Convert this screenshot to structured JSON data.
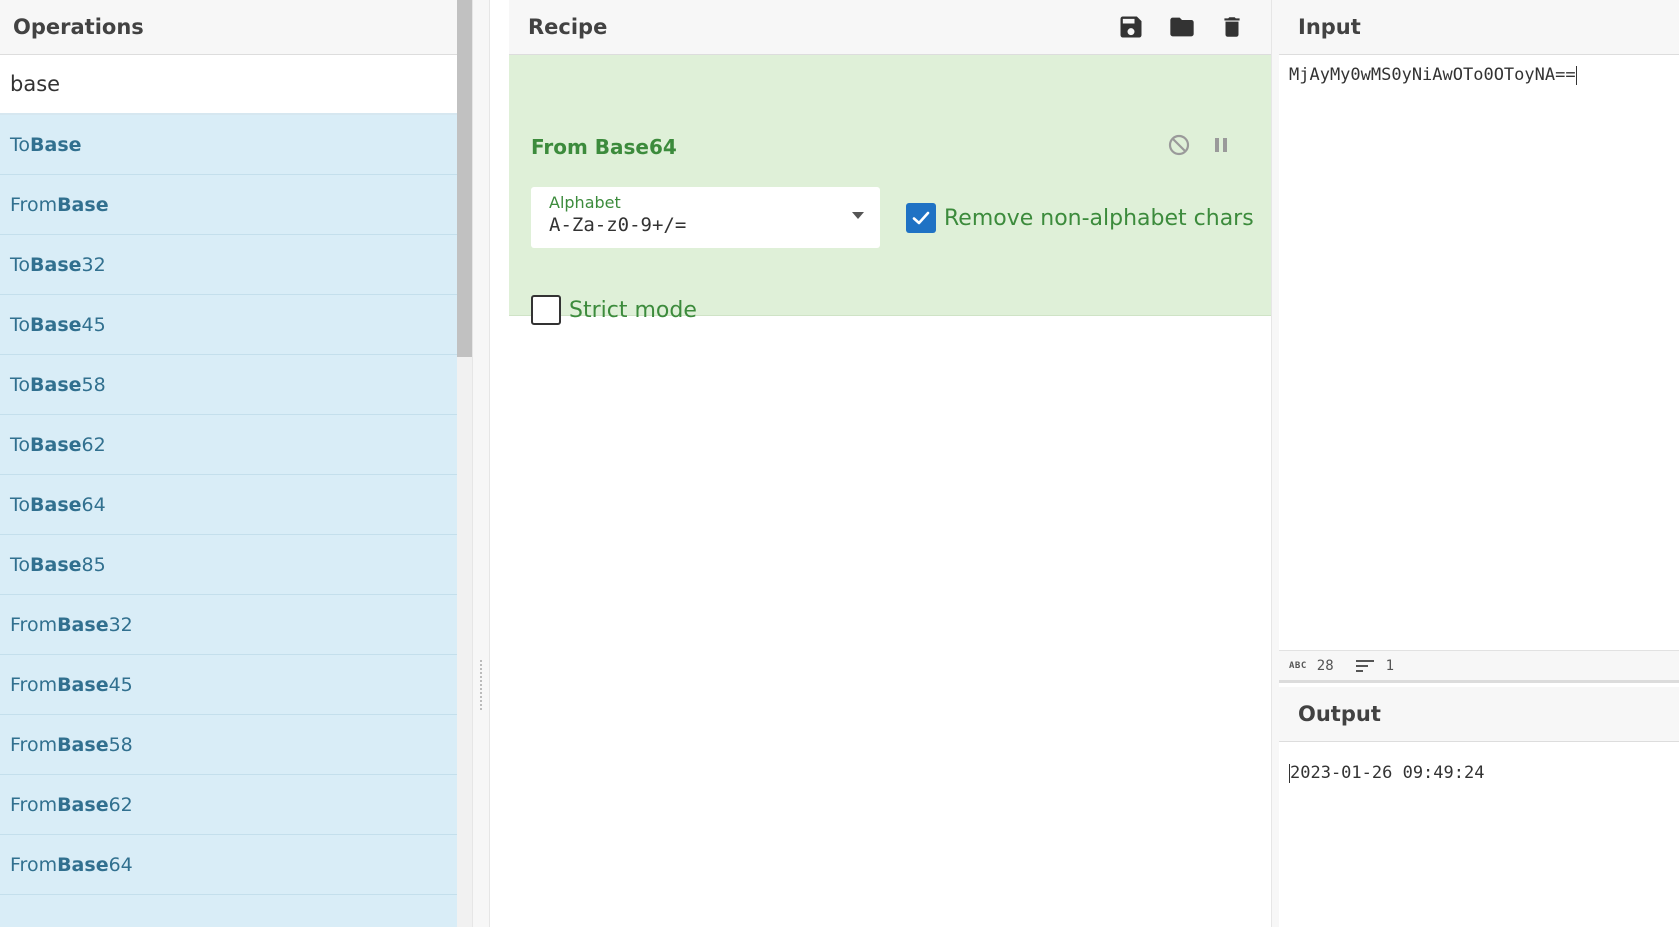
{
  "operations": {
    "title": "Operations",
    "search_value": "base",
    "items": [
      {
        "prefix": "To ",
        "match": "Base",
        "suffix": ""
      },
      {
        "prefix": "From ",
        "match": "Base",
        "suffix": ""
      },
      {
        "prefix": "To ",
        "match": "Base",
        "suffix": "32"
      },
      {
        "prefix": "To ",
        "match": "Base",
        "suffix": "45"
      },
      {
        "prefix": "To ",
        "match": "Base",
        "suffix": "58"
      },
      {
        "prefix": "To ",
        "match": "Base",
        "suffix": "62"
      },
      {
        "prefix": "To ",
        "match": "Base",
        "suffix": "64"
      },
      {
        "prefix": "To ",
        "match": "Base",
        "suffix": "85"
      },
      {
        "prefix": "From ",
        "match": "Base",
        "suffix": "32"
      },
      {
        "prefix": "From ",
        "match": "Base",
        "suffix": "45"
      },
      {
        "prefix": "From ",
        "match": "Base",
        "suffix": "58"
      },
      {
        "prefix": "From ",
        "match": "Base",
        "suffix": "62"
      },
      {
        "prefix": "From ",
        "match": "Base",
        "suffix": "64"
      }
    ]
  },
  "recipe": {
    "title": "Recipe",
    "actions": {
      "save_icon": "save-icon",
      "load_icon": "folder-icon",
      "clear_icon": "trash-icon"
    },
    "operation": {
      "name": "From Base64",
      "alphabet_label": "Alphabet",
      "alphabet_value": "A-Za-z0-9+/=",
      "remove_non_alphabet_label": "Remove non-alphabet chars",
      "remove_non_alphabet_checked": true,
      "strict_mode_label": "Strict mode",
      "strict_mode_checked": false
    }
  },
  "input": {
    "title": "Input",
    "text": "MjAyMy0wMS0yNiAwOTo0OToyNA==",
    "stats": {
      "abc_label": "ABC",
      "length": "28",
      "lines": "1"
    }
  },
  "output": {
    "title": "Output",
    "text": "2023-01-26 09:49:24"
  },
  "colors": {
    "op_list_bg": "#d9edf7",
    "op_list_text": "#31708f",
    "recipe_card_bg": "#dff0d8",
    "recipe_card_text": "#3c8b3c",
    "checkbox_on": "#1f72c4"
  }
}
